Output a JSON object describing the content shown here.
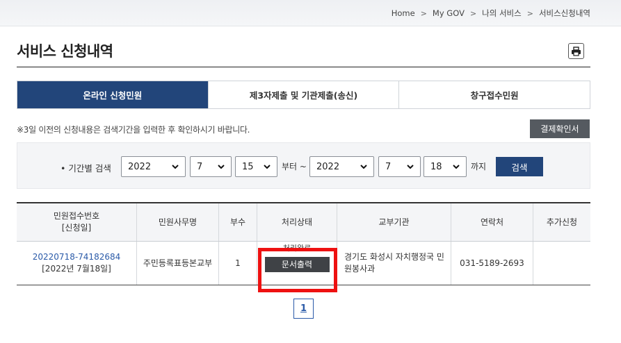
{
  "breadcrumb": {
    "items": [
      "Home",
      "My GOV",
      "나의 서비스",
      "서비스신청내역"
    ]
  },
  "page": {
    "title": "서비스 신청내역"
  },
  "tabs": [
    {
      "label": "온라인 신청민원",
      "active": true
    },
    {
      "label": "제3자제출 및 기관제출(송신)",
      "active": false
    },
    {
      "label": "창구접수민원",
      "active": false
    }
  ],
  "notice": "※3일 이전의 신청내용은 검색기간을 입력한 후 확인하시기 바랍니다.",
  "buttons": {
    "payment_confirm": "결제확인서",
    "search": "검색",
    "print_doc": "문서출력"
  },
  "search": {
    "label": "• 기간별 검색",
    "from": {
      "year": "2022",
      "month": "7",
      "day": "15"
    },
    "to": {
      "year": "2022",
      "month": "7",
      "day": "18"
    },
    "from_word": "부터 ~",
    "to_word": "까지"
  },
  "table": {
    "headers": {
      "receipt_no": "민원접수번호",
      "receipt_date": "[신청일]",
      "service_name": "민원사무명",
      "copies": "부수",
      "status": "처리상태",
      "agency": "교부기관",
      "contact": "연락처",
      "extra": "추가신청"
    },
    "rows": [
      {
        "receipt_no": "20220718-74182684",
        "receipt_date": "[2022년 7월18일]",
        "service_name": "주민등록표등본교부",
        "copies": "1",
        "status": "처리완료",
        "agency": "경기도 화성시 자치행정국 민원봉사과",
        "contact": "031-5189-2693",
        "extra": ""
      }
    ]
  },
  "pagination": {
    "current": "1"
  },
  "colors": {
    "primary": "#22457a",
    "highlight": "#ee1111",
    "dark_button": "#3f4246"
  }
}
